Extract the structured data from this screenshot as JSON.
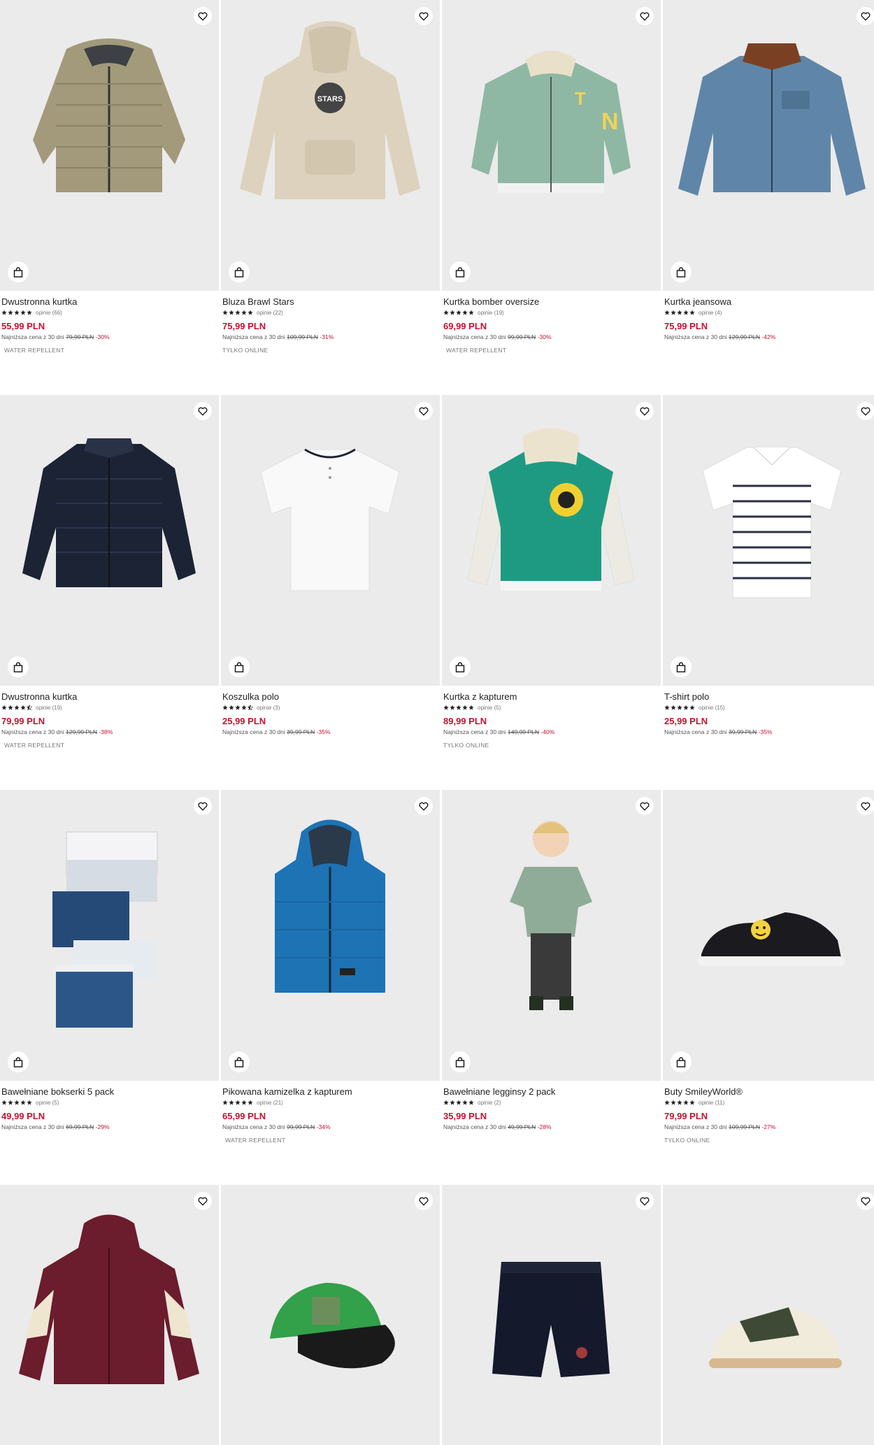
{
  "products": [
    {
      "name": "Dwustronna kurtka",
      "opinions": "opinie (66)",
      "stars": 5,
      "price": "55,99 PLN",
      "lowest_label": "Najniższa cena z 30 dni",
      "old_price": "79,99 PLN",
      "discount": "-30%",
      "badge": "WATER REPELLENT",
      "image": "puffer-jacket-beige"
    },
    {
      "name": "Bluza Brawl Stars",
      "opinions": "opinie (22)",
      "stars": 5,
      "price": "75,99 PLN",
      "lowest_label": "Najniższa cena z 30 dni",
      "old_price": "109,99 PLN",
      "discount": "-31%",
      "badge": "TYLKO ONLINE",
      "image": "hoodie-beige"
    },
    {
      "name": "Kurtka bomber oversize",
      "opinions": "opinie (19)",
      "stars": 5,
      "price": "69,99 PLN",
      "lowest_label": "Najniższa cena z 30 dni",
      "old_price": "99,99 PLN",
      "discount": "-30%",
      "badge": "WATER REPELLENT",
      "image": "bomber-green"
    },
    {
      "name": "Kurtka jeansowa",
      "opinions": "opinie (4)",
      "stars": 5,
      "price": "75,99 PLN",
      "lowest_label": "Najniższa cena z 30 dni",
      "old_price": "129,99 PLN",
      "discount": "-42%",
      "badge": "",
      "image": "denim-jacket"
    },
    {
      "name": "Dwustronna kurtka",
      "opinions": "opinie (19)",
      "stars": 4.5,
      "price": "79,99 PLN",
      "lowest_label": "Najniższa cena z 30 dni",
      "old_price": "129,99 PLN",
      "discount": "-38%",
      "badge": "WATER REPELLENT",
      "image": "puffer-jacket-navy"
    },
    {
      "name": "Koszulka polo",
      "opinions": "opinie (3)",
      "stars": 4.5,
      "price": "25,99 PLN",
      "lowest_label": "Najniższa cena z 30 dni",
      "old_price": "39,99 PLN",
      "discount": "-35%",
      "badge": "",
      "image": "polo-white"
    },
    {
      "name": "Kurtka z kapturem",
      "opinions": "opinie (5)",
      "stars": 5,
      "price": "89,99 PLN",
      "lowest_label": "Najniższa cena z 30 dni",
      "old_price": "149,99 PLN",
      "discount": "-40%",
      "badge": "TYLKO ONLINE",
      "image": "varsity-teal"
    },
    {
      "name": "T-shirt polo",
      "opinions": "opinie (15)",
      "stars": 5,
      "price": "25,99 PLN",
      "lowest_label": "Najniższa cena z 30 dni",
      "old_price": "39,99 PLN",
      "discount": "-35%",
      "badge": "",
      "image": "polo-striped"
    },
    {
      "name": "Bawełniane bokserki 5 pack",
      "opinions": "opinie (5)",
      "stars": 5,
      "price": "49,99 PLN",
      "lowest_label": "Najniższa cena z 30 dni",
      "old_price": "69,99 PLN",
      "discount": "-29%",
      "badge": "",
      "image": "boxers-pack"
    },
    {
      "name": "Pikowana kamizelka z kapturem",
      "opinions": "opinie (21)",
      "stars": 5,
      "price": "65,99 PLN",
      "lowest_label": "Najniższa cena z 30 dni",
      "old_price": "99,99 PLN",
      "discount": "-34%",
      "badge": "WATER REPELLENT",
      "image": "vest-blue"
    },
    {
      "name": "Bawełniane legginsy 2 pack",
      "opinions": "opinie (2)",
      "stars": 5,
      "price": "35,99 PLN",
      "lowest_label": "Najniższa cena z 30 dni",
      "old_price": "49,99 PLN",
      "discount": "-28%",
      "badge": "",
      "image": "child-model"
    },
    {
      "name": "Buty SmileyWorld®",
      "opinions": "opinie (11)",
      "stars": 5,
      "price": "79,99 PLN",
      "lowest_label": "Najniższa cena z 30 dni",
      "old_price": "109,99 PLN",
      "discount": "-27%",
      "badge": "TYLKO ONLINE",
      "image": "sneaker-smiley"
    },
    {
      "name": "",
      "image": "hoodie-burgundy"
    },
    {
      "name": "",
      "image": "cap-green"
    },
    {
      "name": "",
      "image": "shorts-navy"
    },
    {
      "name": "",
      "image": "sneaker-olive"
    }
  ],
  "icons": {
    "favorite": "heart-icon",
    "add_to_cart": "bag-icon",
    "rating": "star-icon"
  },
  "colors": {
    "price": "#c8102e",
    "discount": "#c8102e",
    "image_bg": "#ebebeb"
  }
}
